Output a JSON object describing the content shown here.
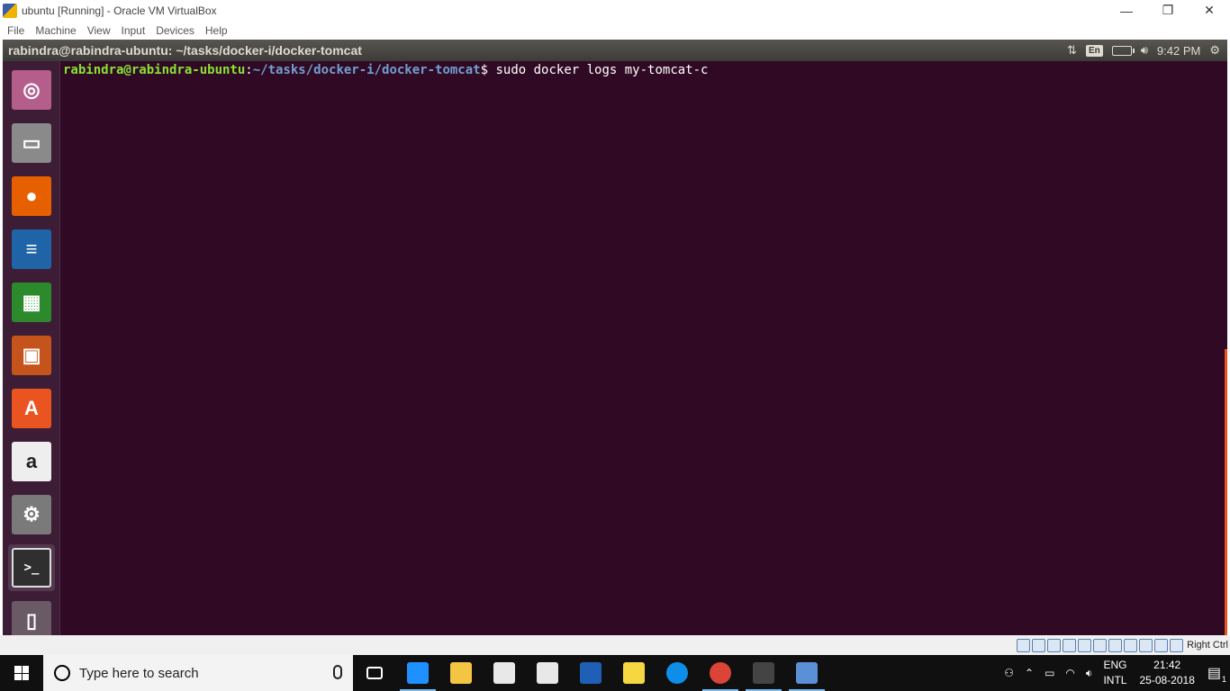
{
  "vbox": {
    "title": "ubuntu [Running] - Oracle VM VirtualBox",
    "menu": [
      "File",
      "Machine",
      "View",
      "Input",
      "Devices",
      "Help"
    ],
    "window_controls": {
      "minimize": "—",
      "restore": "❐",
      "close": "✕"
    },
    "status_host_key": "Right Ctrl"
  },
  "ubuntu": {
    "window_title": "rabindra@rabindra-ubuntu: ~/tasks/docker-i/docker-tomcat",
    "keyboard_indicator": "En",
    "time": "9:42 PM",
    "launcher": [
      {
        "name": "ubuntu-dash-icon",
        "glyph": "◎",
        "color": "#b45e8c"
      },
      {
        "name": "files-icon",
        "glyph": "▭",
        "color": "#8a8a8a"
      },
      {
        "name": "firefox-icon",
        "glyph": "●",
        "color": "#e66000"
      },
      {
        "name": "libreoffice-writer-icon",
        "glyph": "≡",
        "color": "#1f64a6"
      },
      {
        "name": "libreoffice-calc-icon",
        "glyph": "▦",
        "color": "#2c8a2c"
      },
      {
        "name": "libreoffice-impress-icon",
        "glyph": "▣",
        "color": "#c4541b"
      },
      {
        "name": "ubuntu-software-icon",
        "glyph": "A",
        "color": "#e95420"
      },
      {
        "name": "amazon-icon",
        "glyph": "a",
        "color": "#eeeeee"
      },
      {
        "name": "system-settings-icon",
        "glyph": "⚙",
        "color": "#7a7a7a"
      },
      {
        "name": "terminal-icon",
        "glyph": ">_",
        "color": "#2f2f2f"
      },
      {
        "name": "trash-icon",
        "glyph": "▯",
        "color": "#6a5a66"
      }
    ]
  },
  "terminal": {
    "user_host": "rabindra@rabindra-ubuntu",
    "sep": ":",
    "path": "~/tasks/docker-i/docker-tomcat",
    "prompt_end": "$ ",
    "command": "sudo docker logs my-tomcat-c"
  },
  "taskbar": {
    "search_placeholder": "Type here to search",
    "apps": [
      {
        "name": "task-view-icon",
        "color": "#ffffff"
      },
      {
        "name": "edge-icon",
        "color": "#1e90ff"
      },
      {
        "name": "file-explorer-icon",
        "color": "#f4c542"
      },
      {
        "name": "store-icon",
        "color": "#e8e8e8"
      },
      {
        "name": "mail-icon",
        "color": "#e8e8e8"
      },
      {
        "name": "mcafee-icon",
        "color": "#1f5fb5"
      },
      {
        "name": "notepad-icon",
        "color": "#f5d742"
      },
      {
        "name": "teamviewer-icon",
        "color": "#0e8ee9"
      },
      {
        "name": "chrome-icon",
        "color": "#db4437"
      },
      {
        "name": "cmd-icon",
        "color": "#444444"
      },
      {
        "name": "virtualbox-icon",
        "color": "#5b8fd6"
      }
    ],
    "lang_top": "ENG",
    "lang_bottom": "INTL",
    "clock_time": "21:42",
    "clock_date": "25-08-2018",
    "notification_count": "1"
  }
}
